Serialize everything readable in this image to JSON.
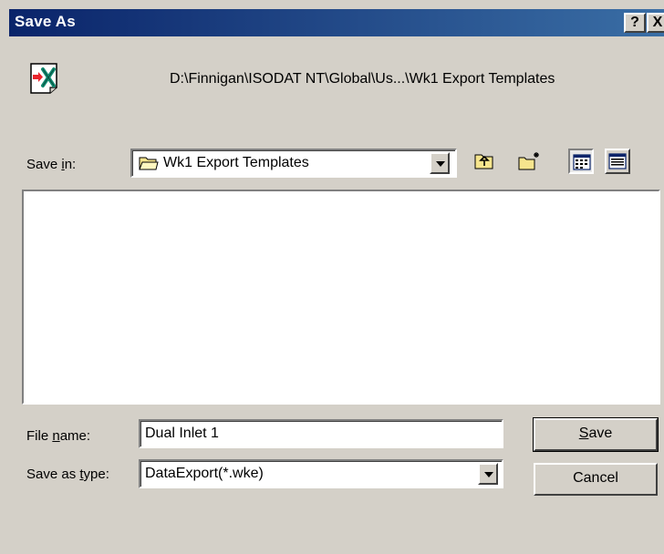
{
  "title_bar": {
    "title": "Save As",
    "help_label": "?",
    "close_label": "X"
  },
  "header": {
    "path": "D:\\Finnigan\\ISODAT NT\\Global\\Us...\\Wk1 Export Templates"
  },
  "save_in": {
    "label_pre": "Save ",
    "label_accel": "i",
    "label_post": "n:",
    "folder_name": "Wk1 Export Templates"
  },
  "file_name": {
    "label_pre": "File ",
    "label_accel": "n",
    "label_post": "ame:",
    "value": "Dual Inlet 1"
  },
  "save_as_type": {
    "label_pre": "Save as ",
    "label_accel": "t",
    "label_post": "ype:",
    "value": "DataExport(*.wke)"
  },
  "buttons": {
    "save_accel": "S",
    "save_rest": "ave",
    "cancel": "Cancel"
  },
  "icons": {
    "app": "excel-export-icon",
    "folder": "folder-icon",
    "up_folder": "up-one-level-icon",
    "new_folder": "new-folder-icon",
    "list_view": "list-view-icon",
    "details_view": "details-view-icon"
  }
}
